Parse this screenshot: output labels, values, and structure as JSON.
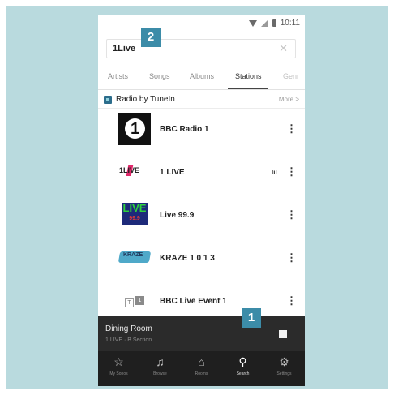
{
  "status": {
    "time": "10:11",
    "icons": [
      "wifi-icon",
      "signal-icon",
      "battery-icon"
    ]
  },
  "search": {
    "value": "1Live",
    "clear_icon": "close-icon"
  },
  "callouts": {
    "search_marker": "2",
    "stop_marker": "1"
  },
  "tabs": [
    {
      "label": "Artists",
      "active": false
    },
    {
      "label": "Songs",
      "active": false
    },
    {
      "label": "Albums",
      "active": false
    },
    {
      "label": "Stations",
      "active": true
    },
    {
      "label": "Genr",
      "active": false
    }
  ],
  "section": {
    "title": "Radio by TuneIn",
    "more_label": "More >"
  },
  "stations": [
    {
      "name": "BBC Radio 1",
      "logo": "bbc-radio-1-logo",
      "logo_text": "1",
      "playing": false
    },
    {
      "name": "1 LIVE",
      "logo": "1live-logo",
      "logo_text": "1LIVE",
      "playing": true,
      "eq_label": "lıl"
    },
    {
      "name": "Live 99.9",
      "logo": "live-99-9-logo",
      "logo_text": "LIVE",
      "logo_subtext": "99.9",
      "playing": false
    },
    {
      "name": "KRAZE 1 0 1 3",
      "logo": "kraze-logo",
      "logo_text": "KRAZE",
      "playing": false
    },
    {
      "name": "BBC Live Event 1",
      "logo": "bbc-live-event-logo",
      "logo_text": "T",
      "logo_subtext": "1",
      "playing": false
    }
  ],
  "now_playing": {
    "room": "Dining Room",
    "subtitle": "1 LIVE · B Section"
  },
  "bottom_nav": [
    {
      "label": "My Sonos",
      "icon": "star-icon",
      "glyph": "☆",
      "active": false
    },
    {
      "label": "Browse",
      "icon": "music-note-icon",
      "glyph": "♫",
      "active": false
    },
    {
      "label": "Rooms",
      "icon": "rooms-icon",
      "glyph": "⌂",
      "active": false
    },
    {
      "label": "Search",
      "icon": "search-icon",
      "glyph": "⚲",
      "active": true
    },
    {
      "label": "Settings",
      "icon": "gear-icon",
      "glyph": "⚙",
      "active": false
    }
  ],
  "colors": {
    "frame_bg": "#b9dade",
    "callout_bg": "#3c8ca8",
    "now_playing_bg": "#2b2b2b",
    "nav_bg": "#1f1f1f"
  }
}
